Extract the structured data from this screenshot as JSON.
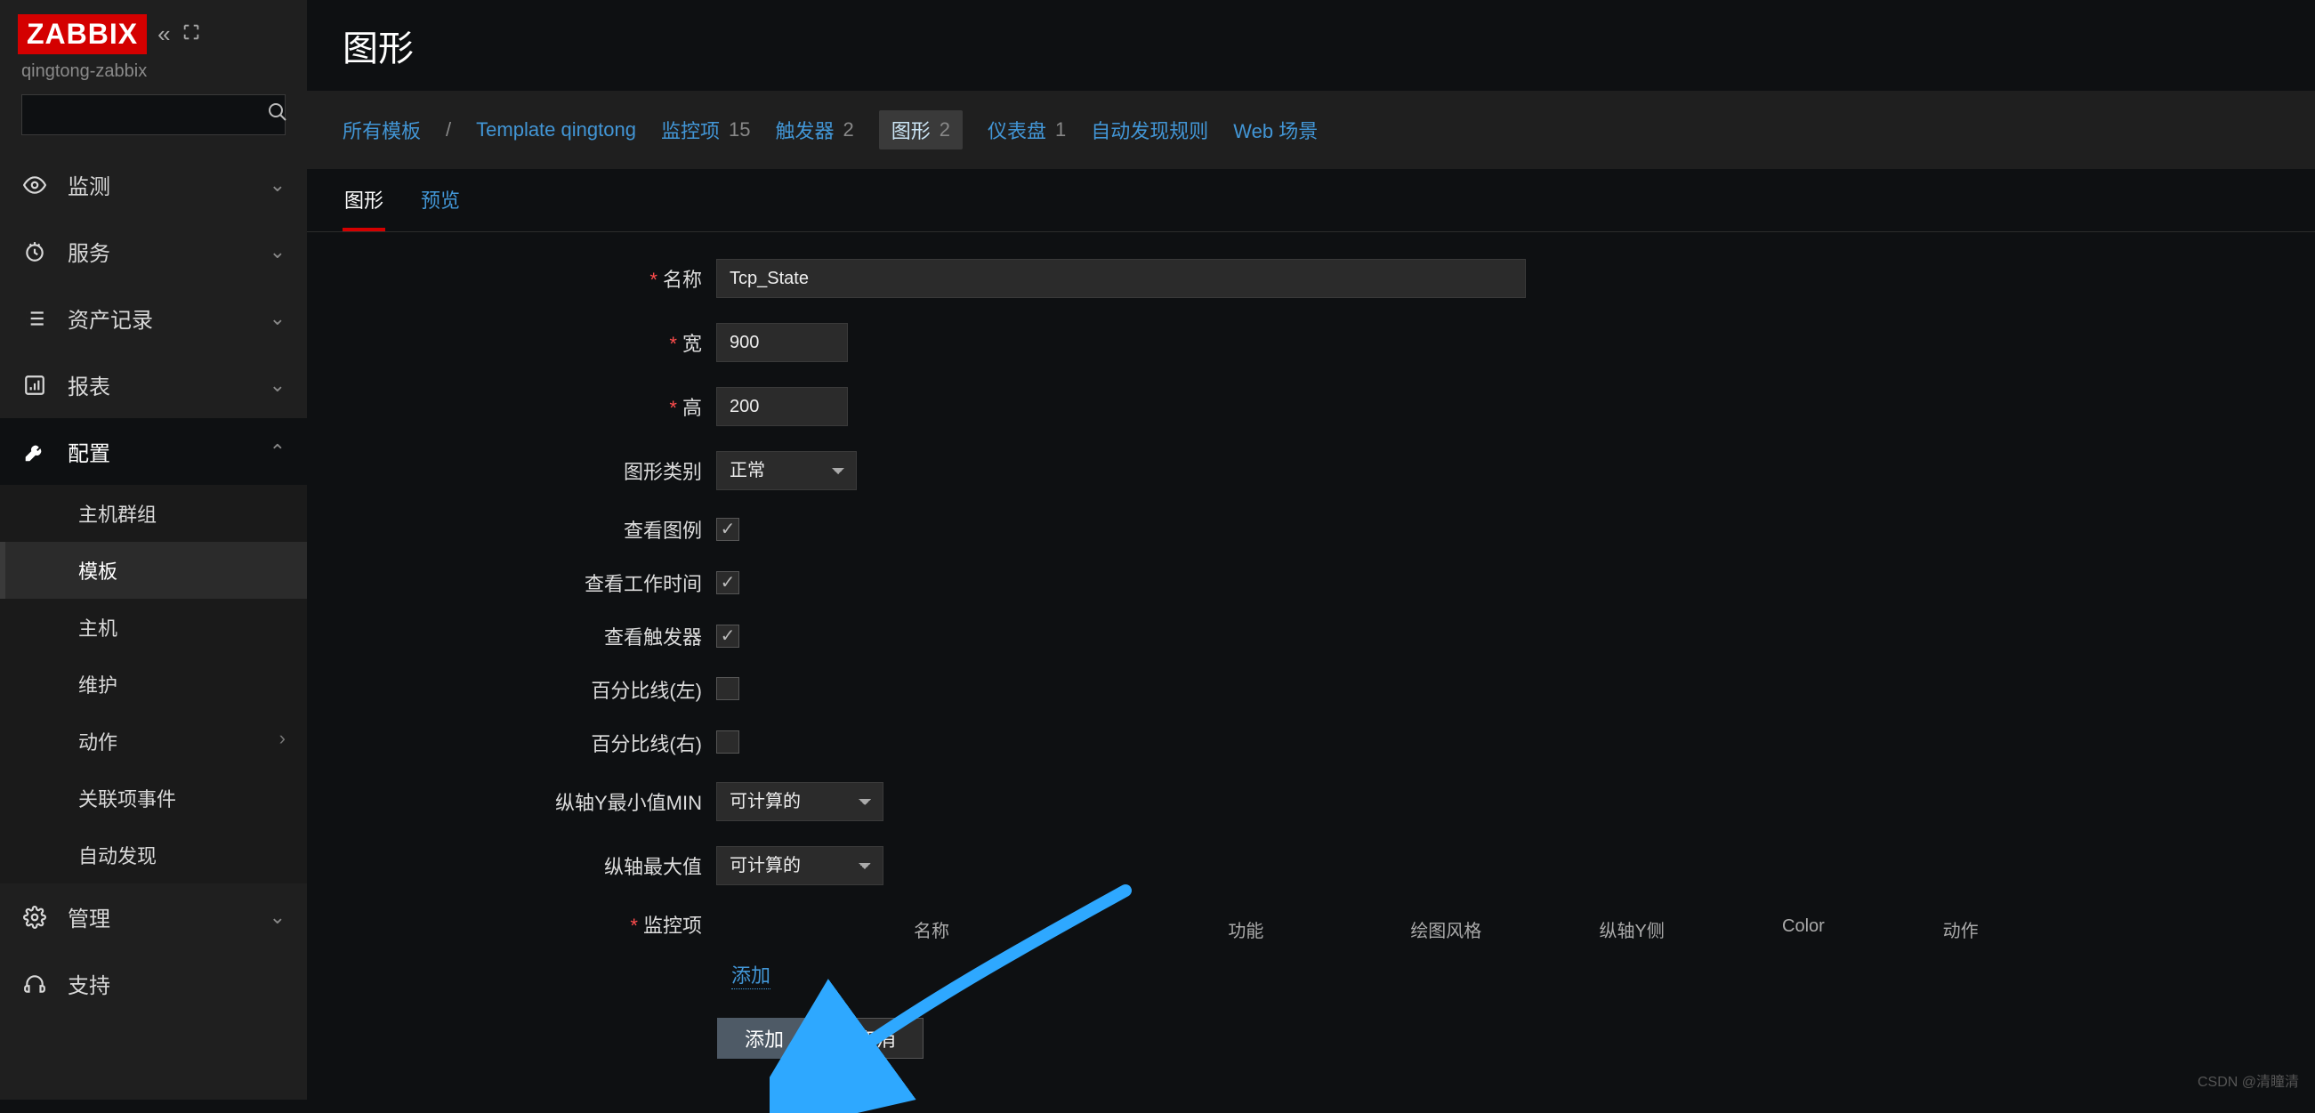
{
  "brand": "ZABBIX",
  "server_name": "qingtong-zabbix",
  "search": {
    "placeholder": ""
  },
  "nav": [
    {
      "icon": "eye",
      "label": "监测",
      "expandable": true
    },
    {
      "icon": "clock",
      "label": "服务",
      "expandable": true
    },
    {
      "icon": "list",
      "label": "资产记录",
      "expandable": true
    },
    {
      "icon": "chart",
      "label": "报表",
      "expandable": true
    },
    {
      "icon": "wrench",
      "label": "配置",
      "expandable": true,
      "expanded": true,
      "children": [
        {
          "label": "主机群组"
        },
        {
          "label": "模板",
          "active": true
        },
        {
          "label": "主机"
        },
        {
          "label": "维护"
        },
        {
          "label": "动作",
          "has_sub": true
        },
        {
          "label": "关联项事件"
        },
        {
          "label": "自动发现"
        }
      ]
    },
    {
      "icon": "gear",
      "label": "管理",
      "expandable": true
    },
    {
      "icon": "headset",
      "label": "支持"
    }
  ],
  "page_title": "图形",
  "breadcrumb": {
    "root": "所有模板",
    "template": "Template qingtong",
    "tabs": [
      {
        "label": "监控项",
        "count": 15
      },
      {
        "label": "触发器",
        "count": 2
      },
      {
        "label": "图形",
        "count": 2,
        "active": true
      },
      {
        "label": "仪表盘",
        "count": 1
      },
      {
        "label": "自动发现规则",
        "count": null
      },
      {
        "label": "Web 场景",
        "count": null
      }
    ]
  },
  "tabs": {
    "graph": "图形",
    "preview": "预览"
  },
  "form": {
    "labels": {
      "name": "名称",
      "width": "宽",
      "height": "高",
      "type": "图形类别",
      "legend": "查看图例",
      "worktime": "查看工作时间",
      "triggers": "查看触发器",
      "pct_left": "百分比线(左)",
      "pct_right": "百分比线(右)",
      "ymin": "纵轴Y最小值MIN",
      "ymax": "纵轴最大值",
      "items": "监控项"
    },
    "values": {
      "name": "Tcp_State",
      "width": "900",
      "height": "200",
      "type": "正常",
      "legend": true,
      "worktime": true,
      "triggers": true,
      "pct_left": false,
      "pct_right": false,
      "ymin": "可计算的",
      "ymax": "可计算的"
    },
    "items_header": {
      "name": "名称",
      "func": "功能",
      "draw": "绘图风格",
      "yaxis": "纵轴Y侧",
      "color": "Color",
      "action": "动作"
    },
    "add_item_link": "添加",
    "buttons": {
      "add": "添加",
      "cancel": "取消"
    }
  },
  "watermark": "CSDN @清瞳清"
}
